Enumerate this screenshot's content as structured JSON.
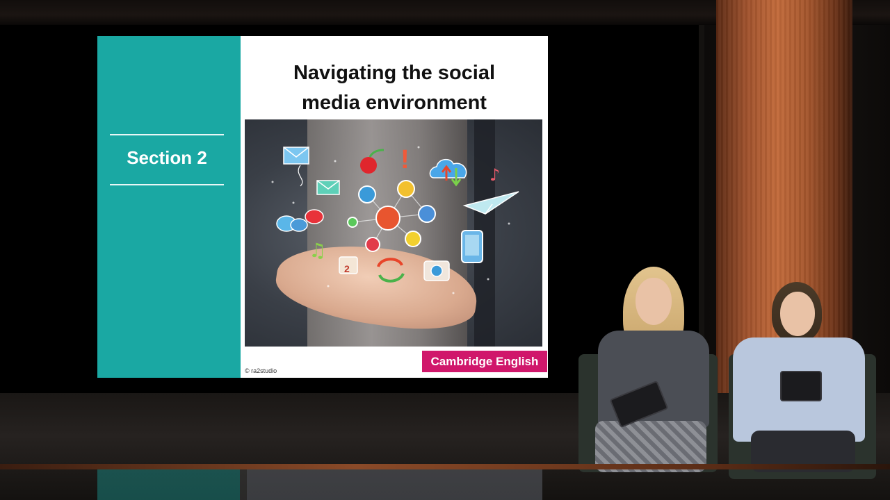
{
  "slide": {
    "section_label": "Section 2",
    "title_line1": "Navigating the social",
    "title_line2": "media environment",
    "copyright": "© ra2studio",
    "brand": "Cambridge English",
    "colors": {
      "sidebar": "#1aa8a3",
      "brand_badge": "#d0176b",
      "title": "#111111"
    }
  },
  "photo_icons": [
    "envelope-icon",
    "apple-icon",
    "exclamation-icon",
    "cloud-sync-icon",
    "music-note-icon",
    "paper-plane-icon",
    "chat-bubbles-icon",
    "user-icon",
    "smartphone-icon",
    "camera-icon",
    "calendar-icon",
    "refresh-icon"
  ],
  "scene": {
    "presenters": [
      "presenter-left",
      "presenter-right"
    ]
  }
}
